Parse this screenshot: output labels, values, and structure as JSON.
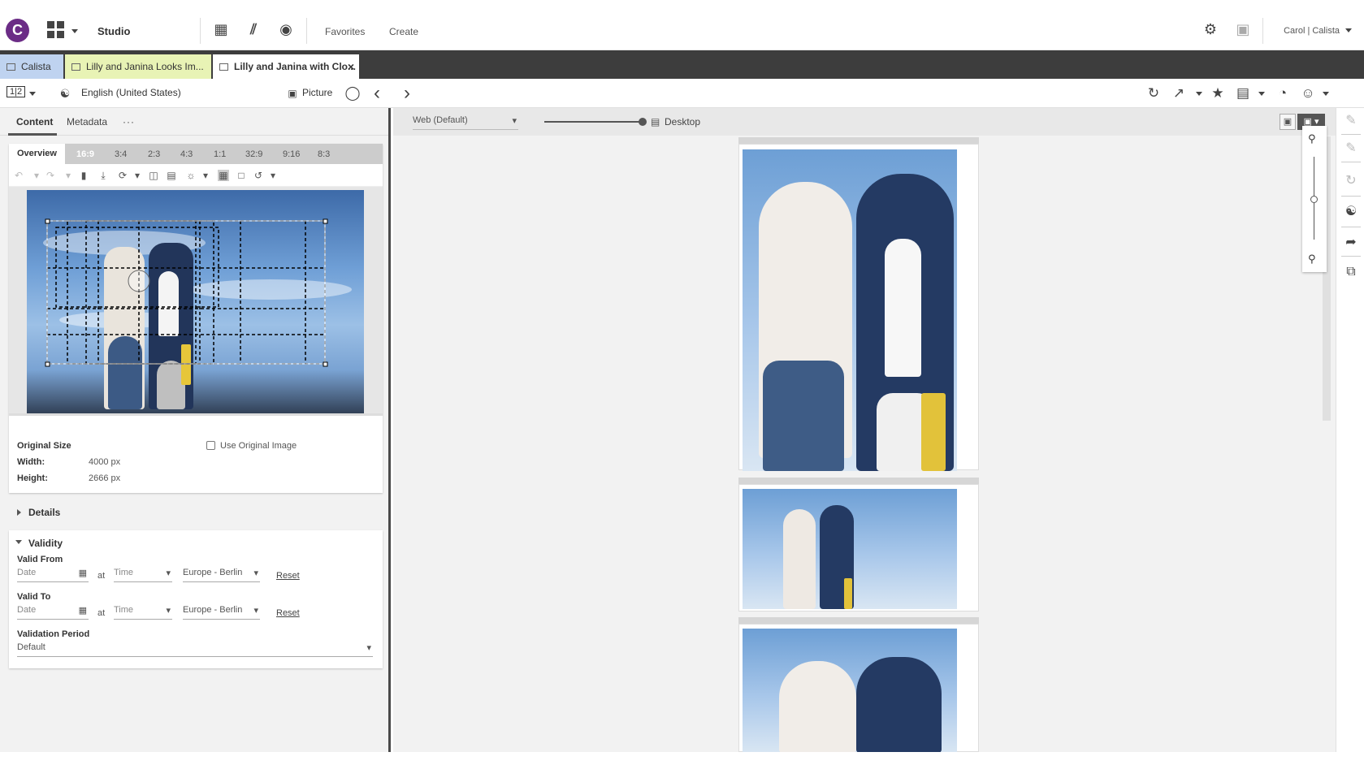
{
  "app": {
    "logo_letter": "C",
    "brand_color": "#6b2c86",
    "title": "Studio",
    "nav_links": [
      "Favorites",
      "Create"
    ],
    "user": "Carol | Calista"
  },
  "tabs": [
    {
      "label": "Calista",
      "bg": "#bfd3f0",
      "active": false
    },
    {
      "label": "Lilly and Janina Looks Im...",
      "bg": "#e8f3b5",
      "active": false
    },
    {
      "label": "Lilly and Janina with Clo...",
      "bg": "#ffffff",
      "active": true,
      "close": "×"
    }
  ],
  "toolbar2": {
    "layout_icon": "1|2",
    "language": "English (United States)",
    "doc_type": "Picture"
  },
  "left_tabs": [
    "Content",
    "Metadata",
    "···"
  ],
  "crop": {
    "overview": "Overview",
    "ratios": [
      "16:9",
      "3:4",
      "2:3",
      "4:3",
      "1:1",
      "32:9",
      "9:16",
      "8:3"
    ],
    "selected_ratio": "16:9"
  },
  "original": {
    "heading": "Original Size",
    "use_original_label": "Use Original Image",
    "width_label": "Width:",
    "width_value": "4000 px",
    "height_label": "Height:",
    "height_value": "2666 px"
  },
  "details": {
    "label": "Details"
  },
  "validity": {
    "label": "Validity",
    "valid_from": "Valid From",
    "valid_to": "Valid To",
    "date_placeholder": "Date",
    "at": "at",
    "time_placeholder": "Time",
    "timezone": "Europe - Berlin",
    "reset": "Reset",
    "period_label": "Validation Period",
    "period_value": "Default"
  },
  "preview": {
    "channel": "Web (Default)",
    "device": "Desktop",
    "slider_level": 1.0
  },
  "icons": {
    "rail": [
      "pen-icon",
      "pen-check-icon",
      "sync-icon",
      "globe-icon",
      "share-icon",
      "copy-icon"
    ]
  }
}
